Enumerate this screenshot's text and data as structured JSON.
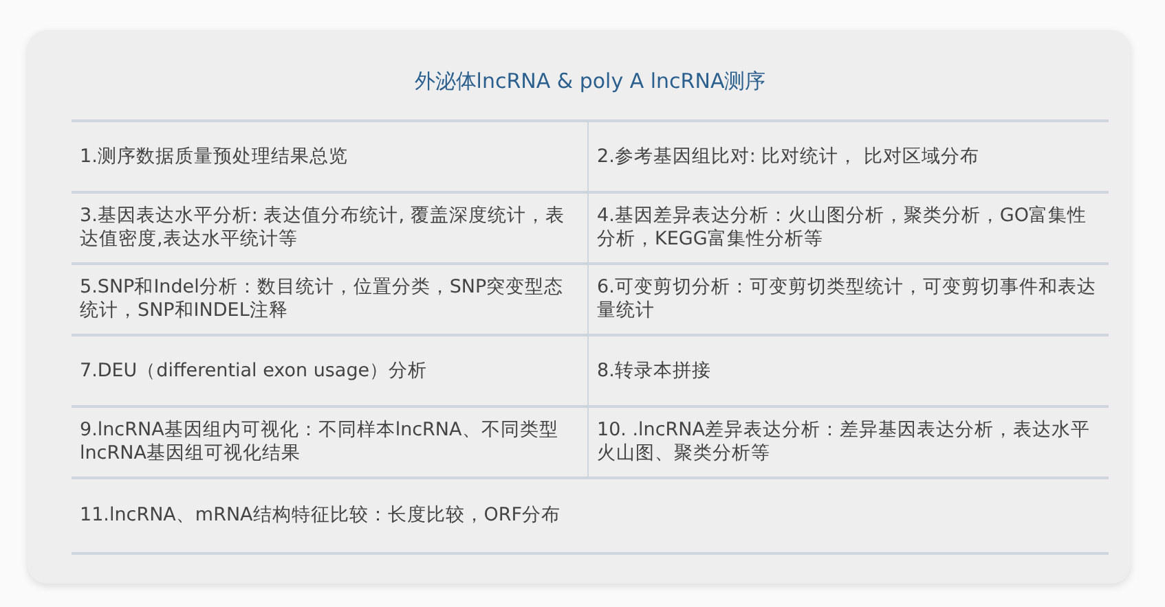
{
  "title": "外泌体lncRNA & poly A lncRNA测序",
  "rows": [
    [
      "1.测序数据质量预处理结果总览",
      "2.参考基因组比对: 比对统计， 比对区域分布"
    ],
    [
      "3.基因表达水平分析: 表达值分布统计, 覆盖深度统计，表达值密度,表达水平统计等",
      "4.基因差异表达分析：火山图分析，聚类分析，GO富集性分析，KEGG富集性分析等"
    ],
    [
      "5.SNP和Indel分析：数目统计，位置分类，SNP突变型态统计，SNP和INDEL注释",
      "6.可变剪切分析：可变剪切类型统计，可变剪切事件和表达量统计"
    ],
    [
      "7.DEU（differential exon usage）分析",
      "8.转录本拼接"
    ],
    [
      "9.lncRNA基因组内可视化：不同样本lncRNA、不同类型lncRNA基因组可视化结果",
      "10. .lncRNA差异表达分析：差异基因表达分析，表达水平火山图、聚类分析等"
    ],
    [
      "11.lncRNA、mRNA结构特征比较：长度比较，ORF分布"
    ]
  ]
}
